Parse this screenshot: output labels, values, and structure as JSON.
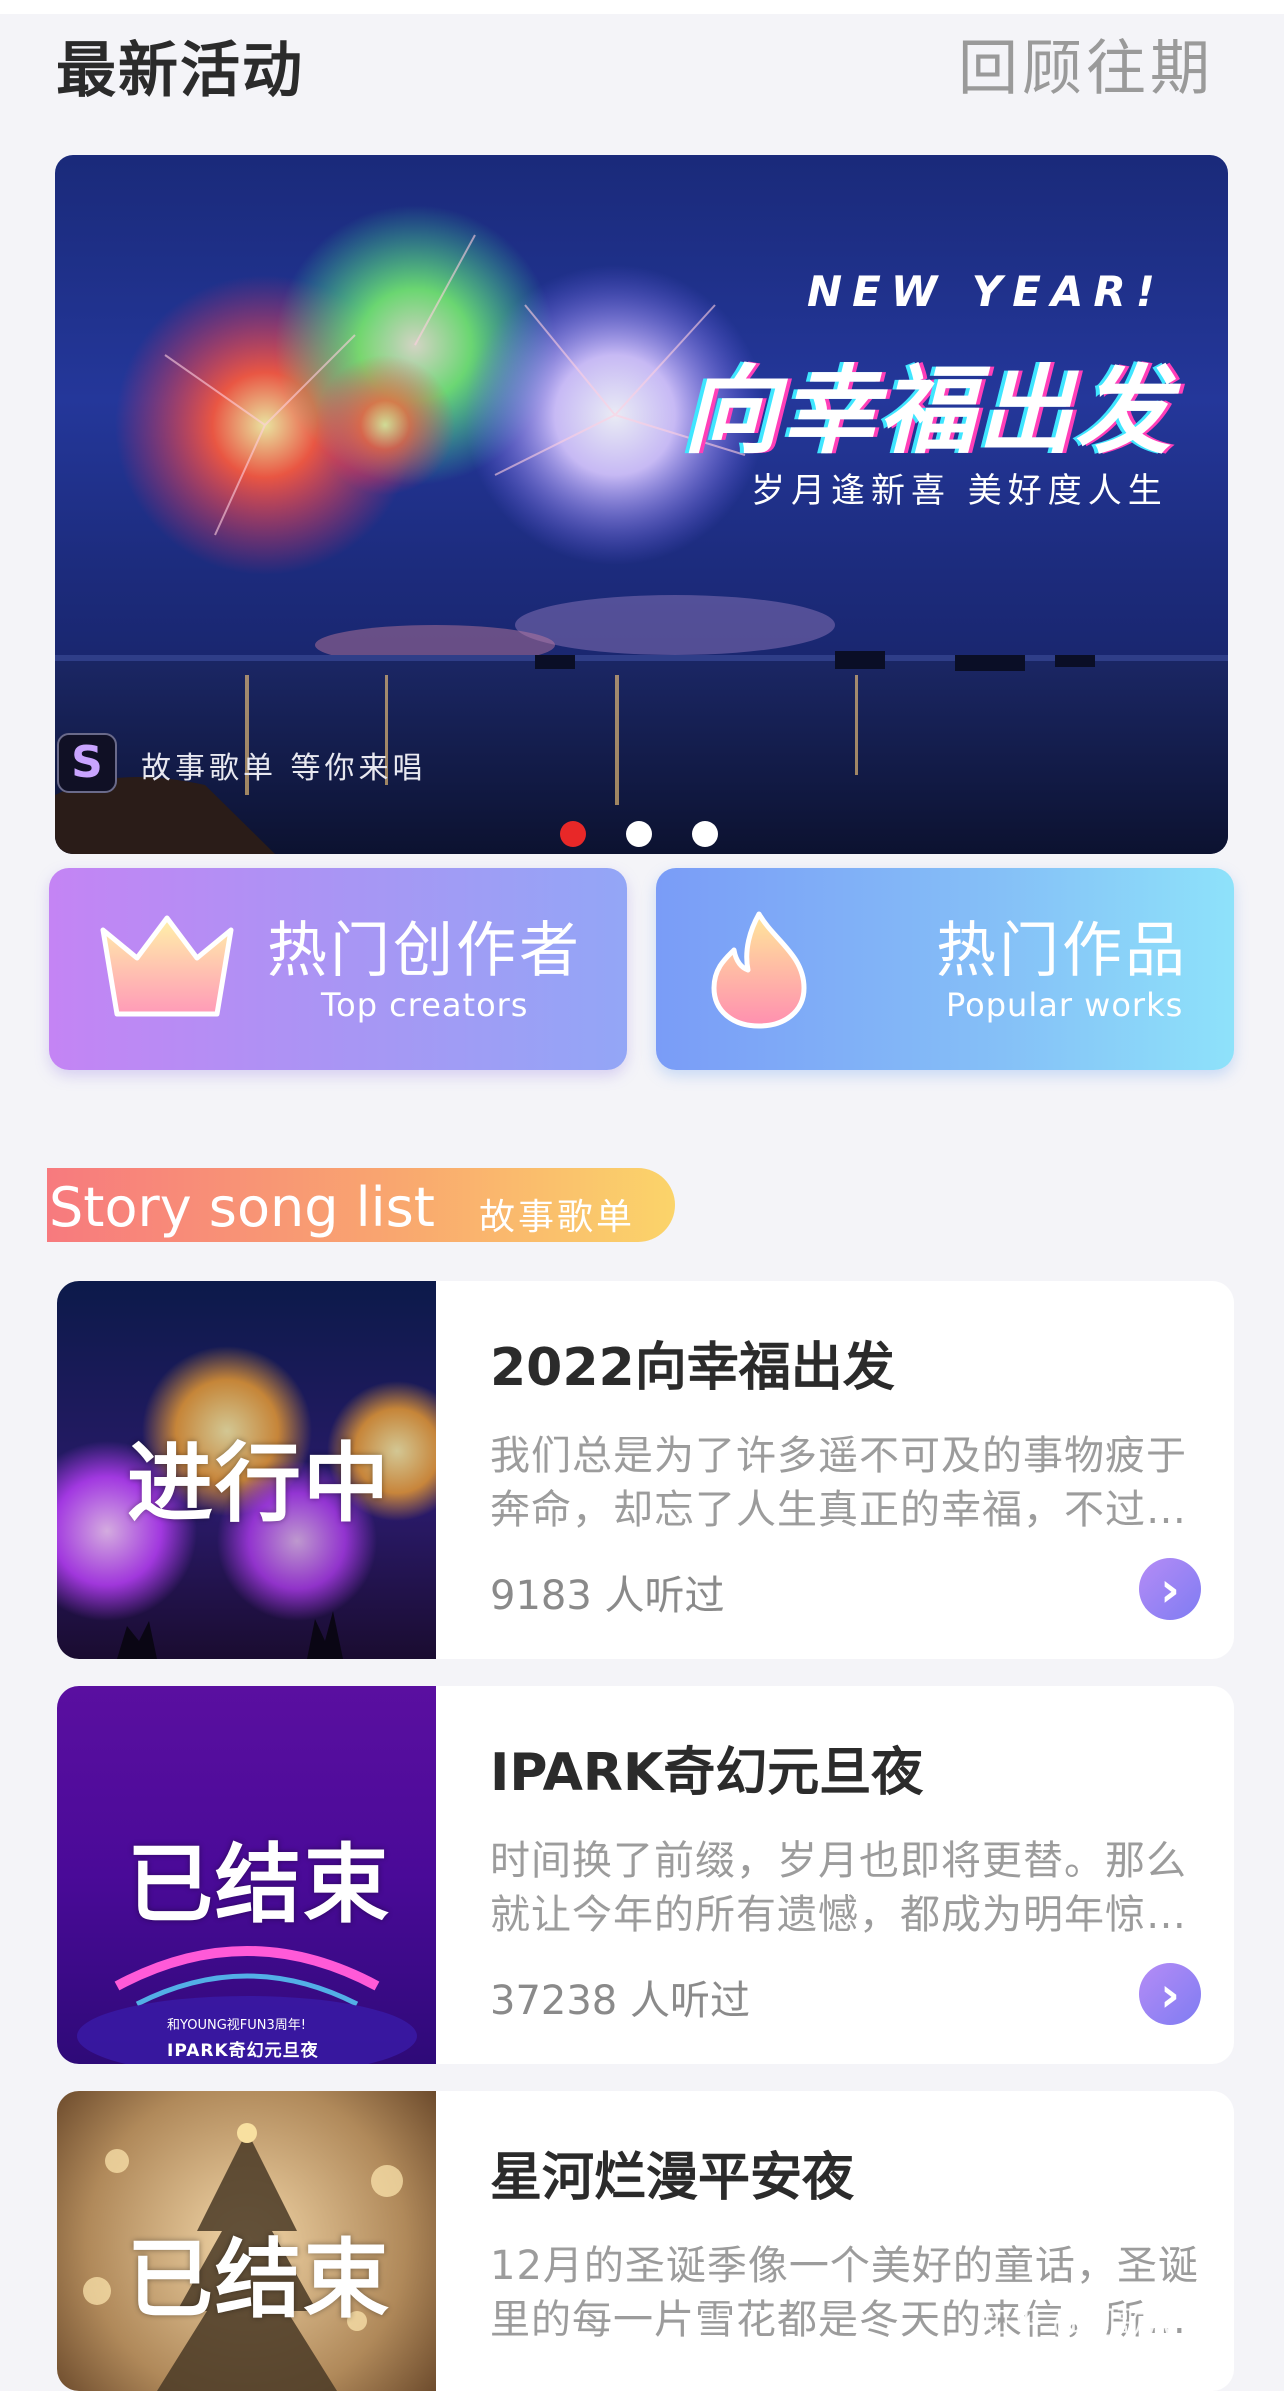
{
  "header": {
    "title": "最新活动",
    "review_link": "回顾往期"
  },
  "banner": {
    "headline_en": "NEW YEAR!",
    "headline_cn": "向幸福出发",
    "subline": "岁月逢新喜 美好度人生",
    "caption": "故事歌单 等你来唱",
    "logo_glyph": "S",
    "pagination": {
      "count": 3,
      "active_index": 0
    }
  },
  "hot_buttons": [
    {
      "title": "热门创作者",
      "subtitle": "Top creators",
      "icon": "crown-icon"
    },
    {
      "title": "热门作品",
      "subtitle": "Popular works",
      "icon": "flame-icon"
    }
  ],
  "section": {
    "title_en": "Story song list",
    "title_cn": "故事歌单"
  },
  "songlists": [
    {
      "title": "2022向幸福出发",
      "description": "我们总是为了许多遥不可及的事物疲于奔命，却忘了人生真正的幸福，不过…",
      "listeners": "9183 人听过",
      "status": "进行中"
    },
    {
      "title": "IPARK奇幻元旦夜",
      "description": "时间换了前缀，岁月也即将更替。那么就让今年的所有遗憾，都成为明年惊…",
      "listeners": "37238 人听过",
      "status": "已结束",
      "thumb_text_1": "和YOUNG视FUN3周年!",
      "thumb_text_2": "IPARK奇幻元旦夜"
    },
    {
      "title": "星河烂漫平安夜",
      "description": "12月的圣诞季像一个美好的童话，圣诞里的每一片雪花都是冬天的来信，所…",
      "listeners": "",
      "status": "已结束"
    }
  ],
  "watermark": "知乎 @闪歌APP",
  "colors": {
    "active_dot": "#e82828",
    "arrow": "#8f82f4"
  }
}
